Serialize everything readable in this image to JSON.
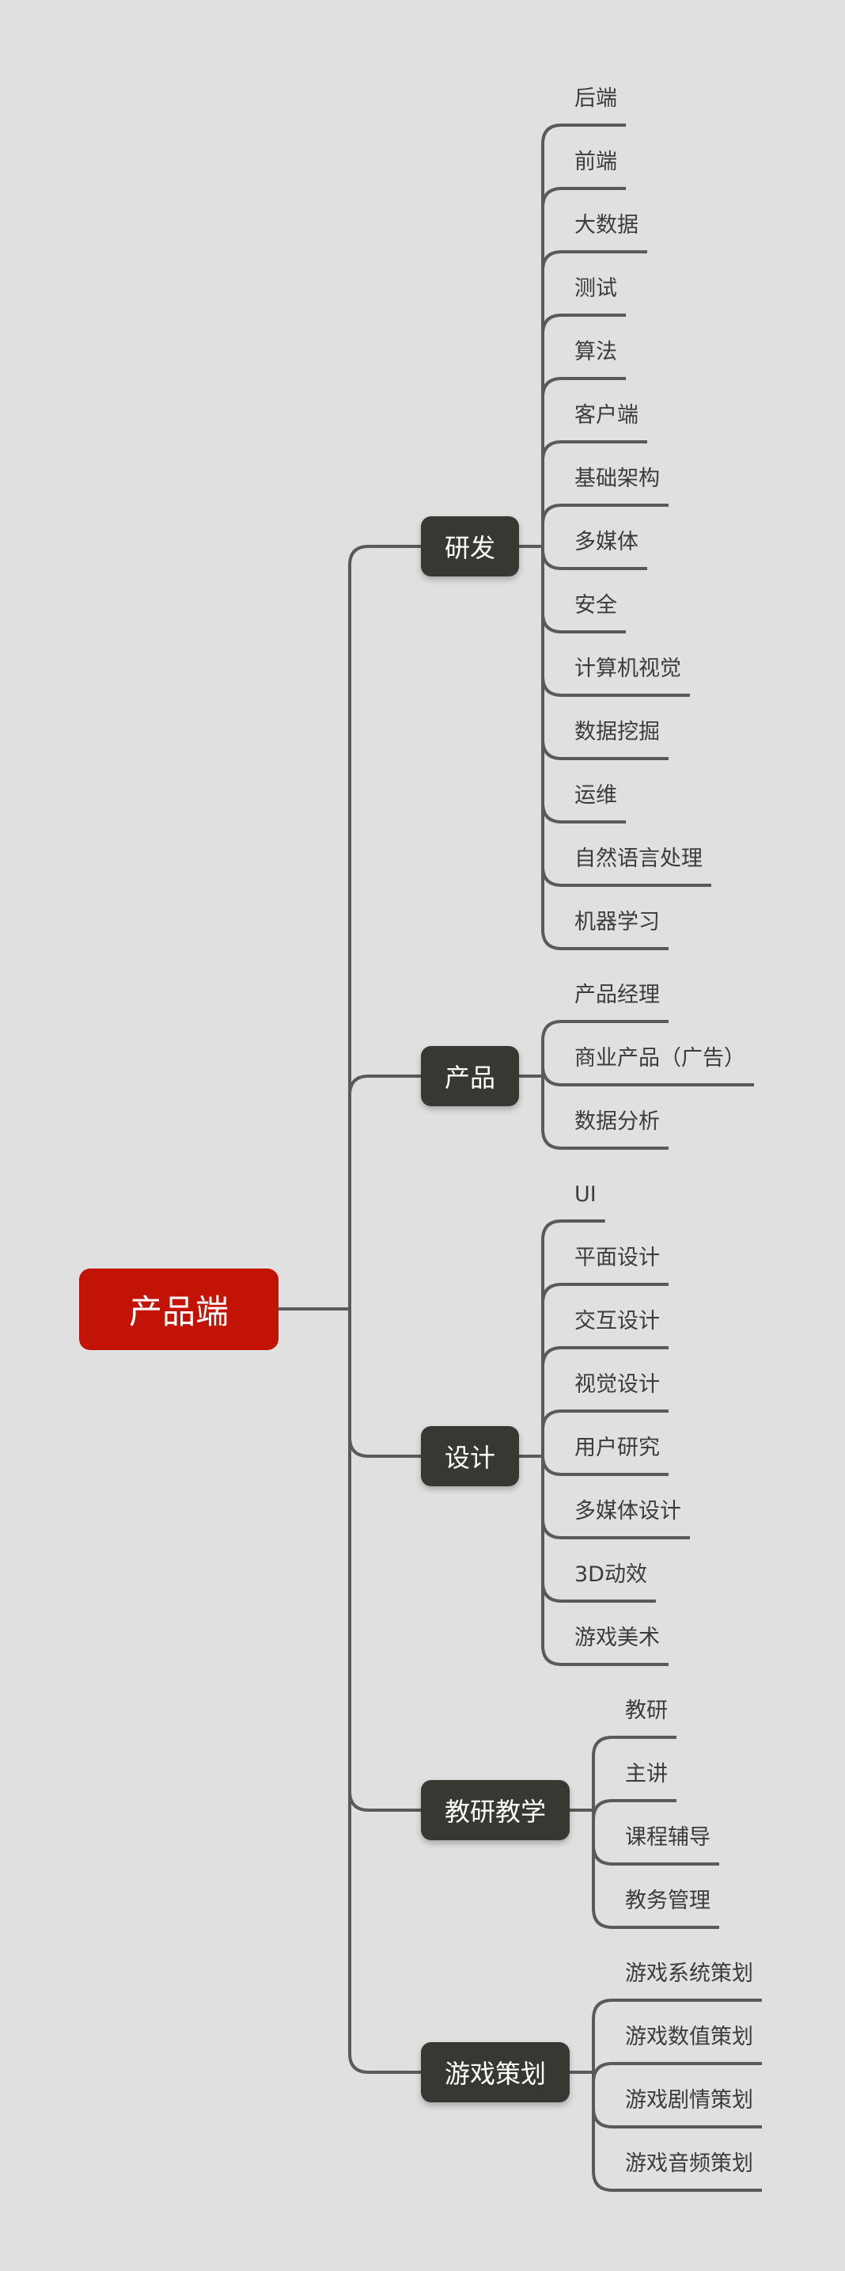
{
  "colors": {
    "background": "#e0e0e0",
    "root": "#c31306",
    "branch": "#383832",
    "edge": "#5a5a5a",
    "leaf_text": "#3c3c3c"
  },
  "root": {
    "label": "产品端"
  },
  "branches": [
    {
      "label": "研发",
      "children": [
        "后端",
        "前端",
        "大数据",
        "测试",
        "算法",
        "客户端",
        "基础架构",
        "多媒体",
        "安全",
        "计算机视觉",
        "数据挖掘",
        "运维",
        "自然语言处理",
        "机器学习"
      ]
    },
    {
      "label": "产品",
      "children": [
        "产品经理",
        "商业产品（广告）",
        "数据分析"
      ]
    },
    {
      "label": "设计",
      "children": [
        "UI",
        "平面设计",
        "交互设计",
        "视觉设计",
        "用户研究",
        "多媒体设计",
        "3D动效",
        "游戏美术"
      ]
    },
    {
      "label": "教研教学",
      "children": [
        "教研",
        "主讲",
        "课程辅导",
        "教务管理"
      ]
    },
    {
      "label": "游戏策划",
      "children": [
        "游戏系统策划",
        "游戏数值策划",
        "游戏剧情策划",
        "游戏音频策划"
      ]
    }
  ]
}
